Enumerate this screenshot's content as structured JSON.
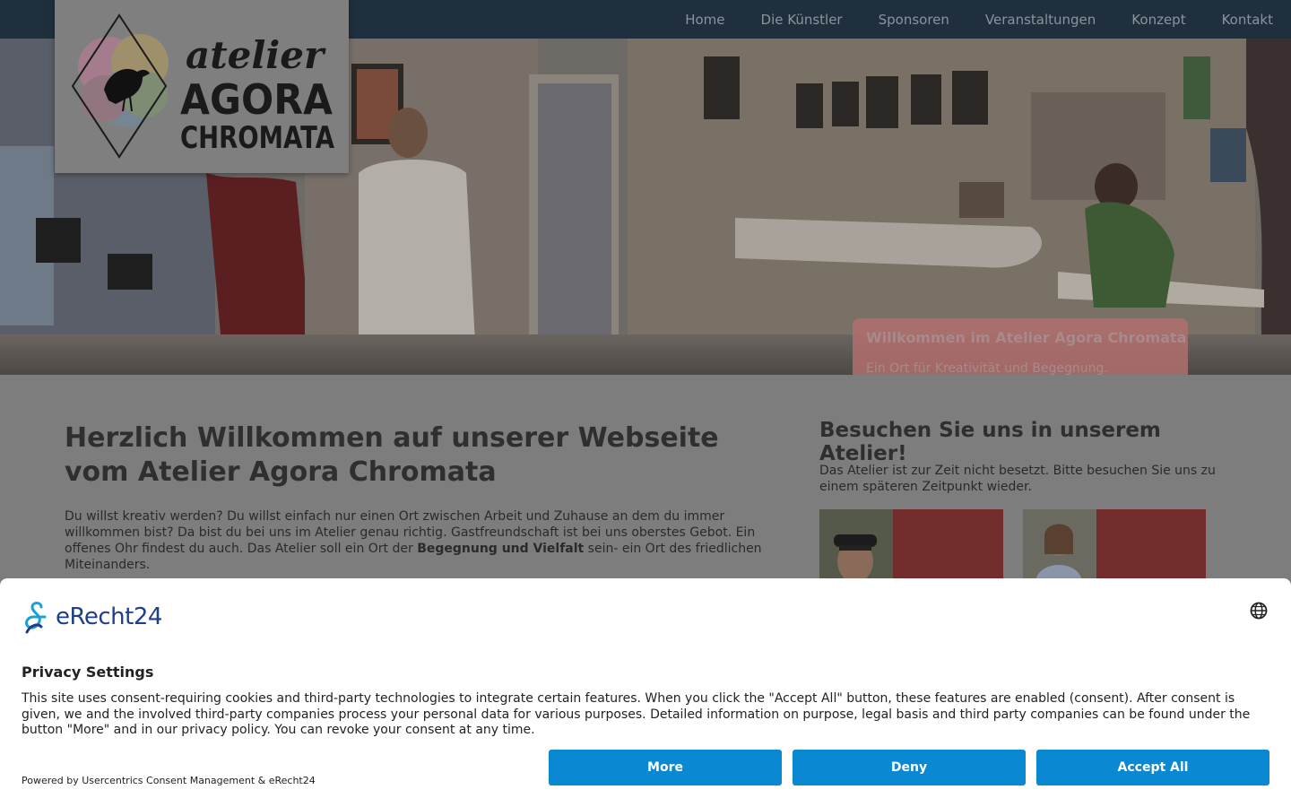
{
  "nav": {
    "items": [
      "Home",
      "Die Künstler",
      "Sponsoren",
      "Veranstaltungen",
      "Konzept",
      "Kontakt"
    ]
  },
  "logo": {
    "line1": "atelier",
    "line2": "AGORA",
    "line3": "CHROMATA"
  },
  "hero": {
    "title": "Willkommen im Atelier Agora Chromata",
    "subtitle": "Ein Ort für Kreativität und Begegnung."
  },
  "main": {
    "heading": "Herzlich Willkommen auf unserer Webseite vom Atelier Agora Chromata",
    "intro_part1": "Du willst kreativ werden? Du willst einfach nur einen Ort zwischen Arbeit und Zuhause an dem du immer willkommen bist? Da bist du bei uns im Atelier genau richtig. Gastfreundschaft ist bei uns oberstes Gebot. Ein offenes Ohr findest du auch. Das Atelier soll ein Ort der ",
    "intro_bold": "Begegnung und Vielfalt",
    "intro_part2": " sein- ein Ort des friedlichen Miteinanders."
  },
  "sidebar": {
    "heading": "Besuchen Sie uns in unserem Atelier!",
    "text": "Das Atelier ist zur Zeit nicht besetzt. Bitte besuchen Sie uns zu einem späteren Zeitpunkt wieder."
  },
  "consent": {
    "brand": "eRecht24",
    "title": "Privacy Settings",
    "description": "This site uses consent-requiring cookies and third-party technologies to integrate certain features. When you click the \"Accept All\" button, these features are enabled (consent). After consent is given, we and the involved third-party companies process your personal data for various purposes. Detailed information on purpose, legal basis and third party companies can be found under the button \"More\" and in our privacy policy. You can revoke your consent at any time.",
    "powered_by": "Powered by Usercentrics Consent Management & eRecht24",
    "buttons": {
      "more": "More",
      "deny": "Deny",
      "accept": "Accept All"
    },
    "button_color": "#0a89d2"
  }
}
